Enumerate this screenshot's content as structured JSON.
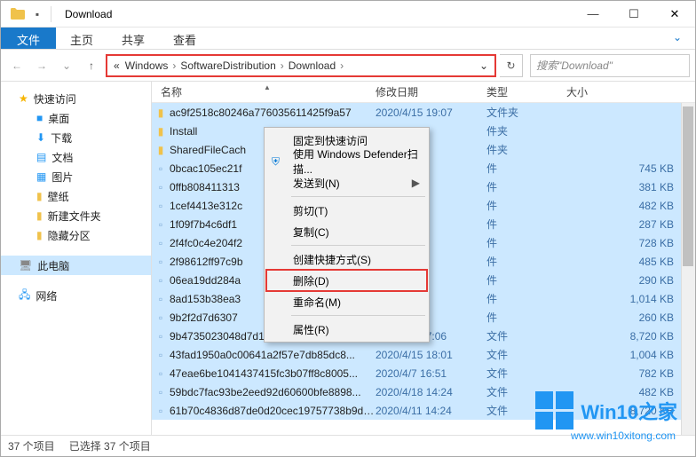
{
  "title": "Download",
  "ribbon": {
    "file": "文件",
    "tabs": [
      "主页",
      "共享",
      "查看"
    ]
  },
  "breadcrumb": {
    "prefix": "«",
    "items": [
      "Windows",
      "SoftwareDistribution",
      "Download"
    ],
    "dropdown": "⌄",
    "refresh": "↻"
  },
  "search": {
    "placeholder": "搜索\"Download\""
  },
  "sidebar": {
    "quick": "快速访问",
    "items": [
      "桌面",
      "下载",
      "文档",
      "图片",
      "壁纸",
      "新建文件夹",
      "隐藏分区"
    ],
    "pc": "此电脑",
    "net": "网络"
  },
  "columns": {
    "name": "名称",
    "date": "修改日期",
    "type": "类型",
    "size": "大小"
  },
  "rows": [
    {
      "icon": "folder",
      "name": "ac9f2518c80246a776035611425f9a57",
      "date": "2020/4/15 19:07",
      "type": "文件夹",
      "size": ""
    },
    {
      "icon": "folder",
      "name": "Install",
      "date": "",
      "type": "件夹",
      "size": ""
    },
    {
      "icon": "folder",
      "name": "SharedFileCach",
      "date": "",
      "type": "件夹",
      "size": ""
    },
    {
      "icon": "file",
      "name": "0bcac105ec21f",
      "date": "",
      "type": "件",
      "size": "745 KB"
    },
    {
      "icon": "file",
      "name": "0ffb808411313",
      "date": "",
      "type": "件",
      "size": "381 KB"
    },
    {
      "icon": "file",
      "name": "1cef4413e312c",
      "date": "",
      "type": "件",
      "size": "482 KB"
    },
    {
      "icon": "file",
      "name": "1f09f7b4c6df1",
      "date": "",
      "type": "件",
      "size": "287 KB"
    },
    {
      "icon": "file",
      "name": "2f4fc0c4e204f2",
      "date": "",
      "type": "件",
      "size": "728 KB"
    },
    {
      "icon": "file",
      "name": "2f98612ff97c9b",
      "date": "",
      "type": "件",
      "size": "485 KB"
    },
    {
      "icon": "file",
      "name": "06ea19dd284a",
      "date": "",
      "type": "件",
      "size": "290 KB"
    },
    {
      "icon": "file",
      "name": "8ad153b38ea3",
      "date": "",
      "type": "件",
      "size": "1,014 KB"
    },
    {
      "icon": "file",
      "name": "9b2f2d7d6307",
      "date": "",
      "type": "件",
      "size": "260 KB"
    },
    {
      "icon": "file",
      "name": "9b4735023048d7d1f0e659537d595713...",
      "date": "2020/4/7 17:06",
      "type": "文件",
      "size": "8,720 KB"
    },
    {
      "icon": "file",
      "name": "43fad1950a0c00641a2f57e7db85dc8...",
      "date": "2020/4/15 18:01",
      "type": "文件",
      "size": "1,004 KB"
    },
    {
      "icon": "file",
      "name": "47eae6be1041437415fc3b07ff8c8005...",
      "date": "2020/4/7 16:51",
      "type": "文件",
      "size": "782 KB"
    },
    {
      "icon": "file",
      "name": "59bdc7fac93be2eed92d60600bfe8898...",
      "date": "2020/4/18 14:24",
      "type": "文件",
      "size": "482 KB"
    },
    {
      "icon": "file",
      "name": "61b70c4836d87de0d20cec19757738b9d9...",
      "date": "2020/4/11 14:24",
      "type": "文件",
      "size": "8,720 KB"
    }
  ],
  "context_menu": [
    {
      "label": "固定到快速访问",
      "type": "item"
    },
    {
      "label": "使用 Windows Defender扫描...",
      "type": "item",
      "icon": "shield"
    },
    {
      "label": "发送到(N)",
      "type": "submenu"
    },
    {
      "type": "sep"
    },
    {
      "label": "剪切(T)",
      "type": "item"
    },
    {
      "label": "复制(C)",
      "type": "item"
    },
    {
      "type": "sep"
    },
    {
      "label": "创建快捷方式(S)",
      "type": "item"
    },
    {
      "label": "删除(D)",
      "type": "item",
      "highlight": true
    },
    {
      "label": "重命名(M)",
      "type": "item"
    },
    {
      "type": "sep"
    },
    {
      "label": "属性(R)",
      "type": "item"
    }
  ],
  "status": {
    "count": "37 个项目",
    "selected": "已选择 37 个项目"
  },
  "logo": {
    "brand": "Win10之家",
    "url": "www.win10xitong.com"
  },
  "winbtns": {
    "min": "—",
    "max": "☐",
    "close": "✕"
  },
  "icons": {
    "back": "←",
    "fwd": "→",
    "down": "⌄",
    "up": "↑",
    "chevron": "›",
    "folder": "📁"
  }
}
